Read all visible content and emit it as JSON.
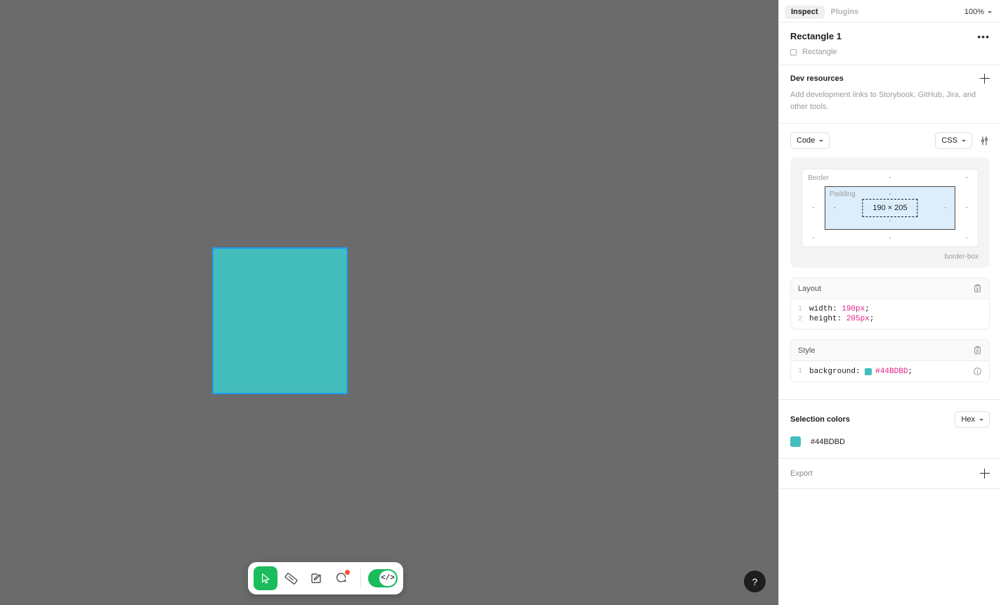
{
  "panel": {
    "tabs": [
      {
        "label": "Inspect",
        "selected": true
      },
      {
        "label": "Plugins",
        "selected": false
      }
    ],
    "zoom": "100%",
    "selection": {
      "title": "Rectangle 1",
      "type": "Rectangle",
      "menu_label": "•••"
    },
    "dev_resources": {
      "title": "Dev resources",
      "description": "Add development links to Storybook, GitHub, Jira, and other tools."
    },
    "controls": {
      "code_label": "Code",
      "language_label": "CSS"
    },
    "box_model": {
      "border_label": "Border",
      "padding_label": "Padding",
      "content_size": "190 × 205",
      "sizing_label": "border-box",
      "dash": "-"
    },
    "layout_block": {
      "title": "Layout",
      "lines": [
        {
          "num": "1",
          "prop": "width",
          "value": "190px"
        },
        {
          "num": "2",
          "prop": "height",
          "value": "205px"
        }
      ]
    },
    "style_block": {
      "title": "Style",
      "line_num": "1",
      "prop": "background",
      "value": "#44BDBD",
      "swatch_color": "#44BDBD"
    },
    "selection_colors": {
      "title": "Selection colors",
      "format": "Hex",
      "items": [
        {
          "hex": "#44BDBD",
          "color": "#44BDBD"
        }
      ]
    },
    "export": {
      "title": "Export"
    }
  },
  "canvas": {
    "shape": {
      "name": "Rectangle 1",
      "fill": "#44BDBD",
      "selection_color": "#1e9cf5",
      "width": "190",
      "height": "205"
    },
    "background": "#6b6b6b"
  },
  "toolbar": {
    "tools": [
      {
        "name": "move-tool",
        "active": true
      },
      {
        "name": "measure-tool",
        "active": false
      },
      {
        "name": "annotate-tool",
        "active": false
      },
      {
        "name": "comment-tool",
        "active": false,
        "badge": true
      }
    ],
    "dev_mode_toggle": {
      "label": "</>",
      "on": true
    }
  },
  "help_button": {
    "label": "?"
  }
}
